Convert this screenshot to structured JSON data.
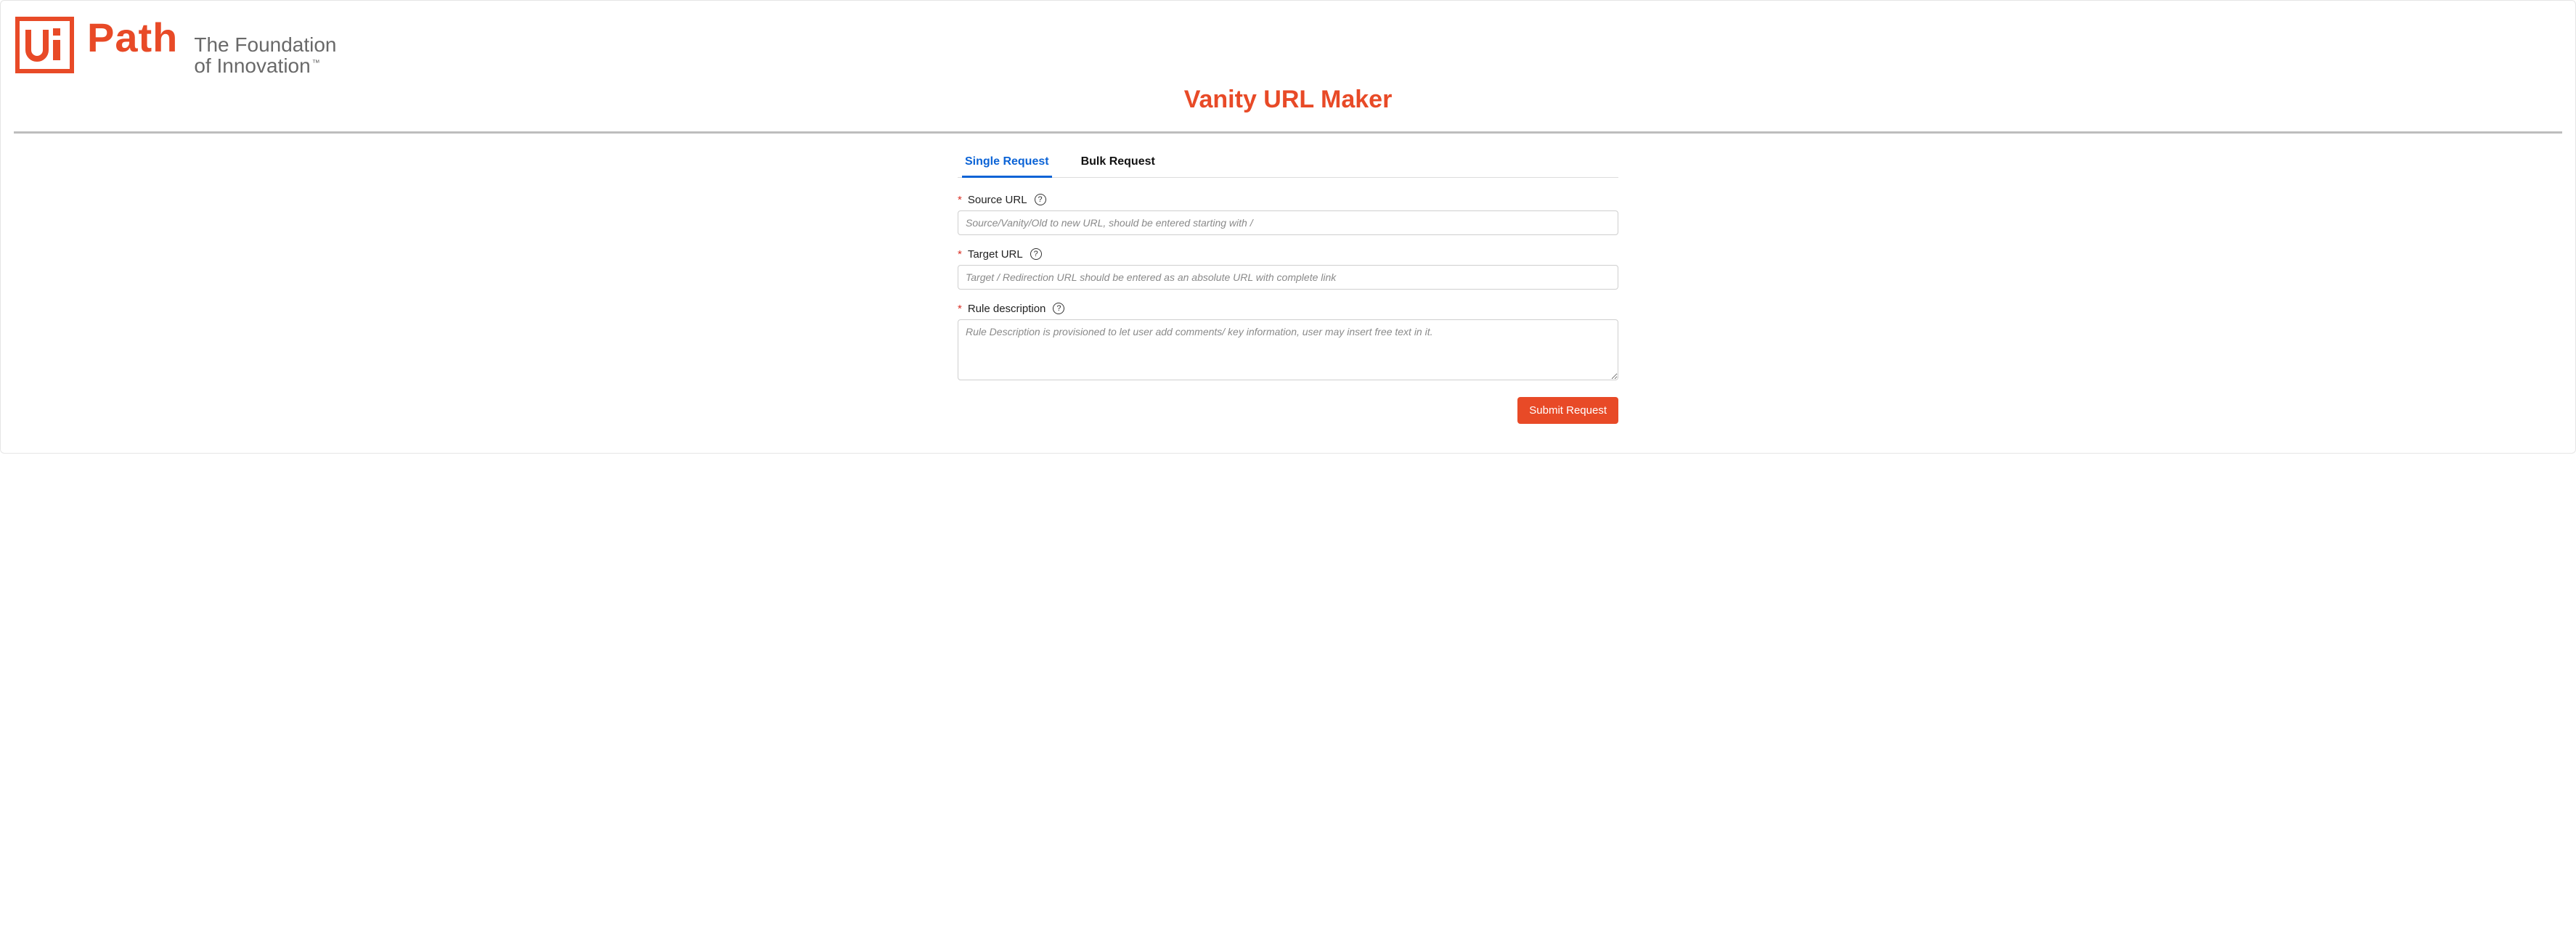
{
  "brand": {
    "mark_text": "Ui",
    "wordmark": "Path",
    "tagline_line1": "The Foundation",
    "tagline_line2": "of Innovation",
    "trademark": "™",
    "accent_color": "#e84a27"
  },
  "page": {
    "title": "Vanity URL Maker"
  },
  "tabs": [
    {
      "label": "Single Request",
      "active": true
    },
    {
      "label": "Bulk Request",
      "active": false
    }
  ],
  "form": {
    "source_url": {
      "label": "Source URL",
      "required": true,
      "value": "",
      "placeholder": "Source/Vanity/Old to new URL, should be entered starting with /"
    },
    "target_url": {
      "label": "Target URL",
      "required": true,
      "value": "",
      "placeholder": "Target / Redirection URL should be entered as an absolute URL with complete link"
    },
    "rule_description": {
      "label": "Rule description",
      "required": true,
      "value": "",
      "placeholder": "Rule Description is provisioned to let user add comments/ key information, user may insert free text in it."
    },
    "submit_label": "Submit Request"
  },
  "glyphs": {
    "required_mark": "*",
    "help_mark": "?"
  }
}
